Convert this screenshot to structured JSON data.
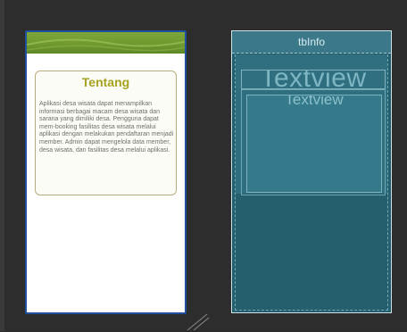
{
  "design": {
    "card_title": "Tentang",
    "card_body": "Aplikasi desa wisata dapat menampilkan informasi berbagai macam desa wisata dan sarana yang dimiliki desa. Pengguna dapat mem-booking fasilitas desa wisata melalui aplikasi dengan melakukan pendaftaran menjadi member. Admin dapat mengelola data member, desa wisata, dan fasilitas desa melalui aplikasi."
  },
  "blueprint": {
    "title": "tbInfo",
    "textview_1": "Textview",
    "textview_2": "Textview"
  },
  "colors": {
    "header_green": "#6f9a2f",
    "title_olive": "#a6a11f",
    "blueprint_bg": "#255f6e",
    "phone_border_blue": "#1f4f9e"
  },
  "icons": {
    "resize_handle": "resize-handle-icon"
  }
}
